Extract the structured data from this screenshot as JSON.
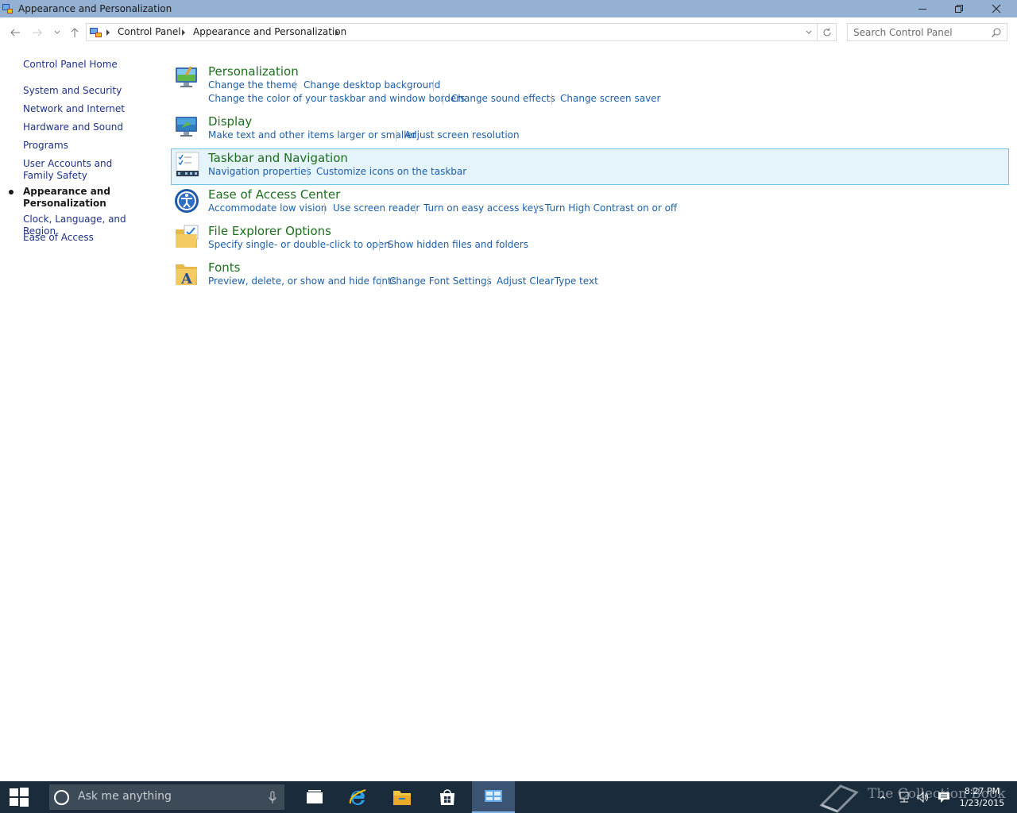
{
  "window": {
    "title": "Appearance and Personalization",
    "controls": {
      "minimize": "minimize-icon",
      "restore": "restore-icon",
      "close": "close-icon"
    }
  },
  "addressbar": {
    "breadcrumbs": [
      "Control Panel",
      "Appearance and Personalization"
    ],
    "search_placeholder": "Search Control Panel"
  },
  "sidebar": {
    "home": "Control Panel Home",
    "items": [
      {
        "label": "System and Security"
      },
      {
        "label": "Network and Internet"
      },
      {
        "label": "Hardware and Sound"
      },
      {
        "label": "Programs"
      },
      {
        "label": "User Accounts and Family Safety"
      },
      {
        "label": "Appearance and Personalization",
        "current": true
      },
      {
        "label": "Clock, Language, and Region"
      },
      {
        "label": "Ease of Access"
      }
    ]
  },
  "categories": [
    {
      "title": "Personalization",
      "icon": "personalization-icon",
      "links": [
        "Change the theme",
        "Change desktop background",
        "Change the color of your taskbar and window borders",
        "Change sound effects",
        "Change screen saver"
      ]
    },
    {
      "title": "Display",
      "icon": "display-icon",
      "links": [
        "Make text and other items larger or smaller",
        "Adjust screen resolution"
      ]
    },
    {
      "title": "Taskbar and Navigation",
      "icon": "taskbar-icon",
      "highlighted": true,
      "links": [
        "Navigation properties",
        "Customize icons on the taskbar"
      ]
    },
    {
      "title": "Ease of Access Center",
      "icon": "ease-of-access-icon",
      "links": [
        "Accommodate low vision",
        "Use screen reader",
        "Turn on easy access keys",
        "Turn High Contrast on or off"
      ]
    },
    {
      "title": "File Explorer Options",
      "icon": "folder-options-icon",
      "links": [
        "Specify single- or double-click to open",
        "Show hidden files and folders"
      ]
    },
    {
      "title": "Fonts",
      "icon": "fonts-icon",
      "links": [
        "Preview, delete, or show and hide fonts",
        "Change Font Settings",
        "Adjust ClearType text"
      ]
    }
  ],
  "taskbar": {
    "search_placeholder": "Ask me anything",
    "apps": [
      "task-view-icon",
      "internet-explorer-icon",
      "file-explorer-icon",
      "store-icon",
      "control-panel-icon"
    ],
    "clock": {
      "time": "8:27 PM",
      "date": "1/23/2015"
    },
    "watermark": "The Collection Book"
  },
  "colors": {
    "titlebar": "#94b1d3",
    "category_title": "#1e6e1e",
    "link": "#1e5fa8",
    "nav_link": "#1e3287",
    "highlight_bg": "#e5f3fb",
    "highlight_border": "#72c3e8",
    "taskbar": "#1a2b3c"
  }
}
